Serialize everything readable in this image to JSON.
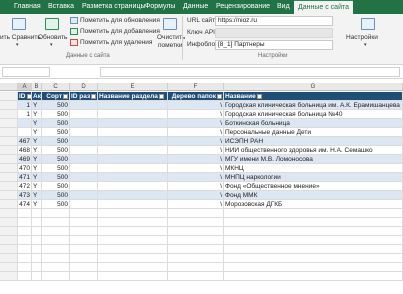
{
  "ribbon_tabs": [
    {
      "label": "Главная",
      "active": false
    },
    {
      "label": "Вставка",
      "active": false
    },
    {
      "label": "Разметка страницы",
      "active": false
    },
    {
      "label": "Формулы",
      "active": false
    },
    {
      "label": "Данные",
      "active": false
    },
    {
      "label": "Рецензирование",
      "active": false
    },
    {
      "label": "Вид",
      "active": false
    },
    {
      "label": "Данные с сайта",
      "active": true
    }
  ],
  "ribbon": {
    "btn_compare": "ить Сравнить",
    "btn_update": "Обновить",
    "mark_update": "Пометить для обновления",
    "mark_add": "Пометить для добавления",
    "mark_delete": "Пометить для удаления",
    "clear_marks_line1": "Очистить",
    "clear_marks_line2": "пометки",
    "group_label": "Данные с сайта",
    "site_url_label": "URL сайта",
    "site_url_value": "https://nioz.ru",
    "api_key_label": "Ключ API",
    "infoblock_label": "Инфоблок",
    "infoblock_value": "[8_1] Партнеры",
    "settings_label": "Настройки",
    "settings_group_label": "Настройки"
  },
  "columns": [
    {
      "letter": "A"
    },
    {
      "letter": "B"
    },
    {
      "letter": "C"
    },
    {
      "letter": "D"
    },
    {
      "letter": "E"
    },
    {
      "letter": "F"
    },
    {
      "letter": "G"
    }
  ],
  "table": {
    "headers": [
      "ID",
      "Акт",
      "Сорт",
      "ID раз",
      "Название раздела",
      "Дерево папок",
      "Название"
    ],
    "rows": [
      {
        "id": "1",
        "active": "Y",
        "sort": "500",
        "tree": "\\",
        "name": "Городская клиническая больница им. А.К. Ерамишанцева"
      },
      {
        "id": "1",
        "active": "Y",
        "sort": "500",
        "tree": "\\",
        "name": "Городская клиническая больница №40"
      },
      {
        "id": "",
        "active": "Y",
        "sort": "500",
        "tree": "\\",
        "name": "Боткинская больница"
      },
      {
        "id": "",
        "active": "Y",
        "sort": "500",
        "tree": "\\",
        "name": "Персональные данные Дети"
      },
      {
        "id": "467",
        "active": "Y",
        "sort": "500",
        "tree": "\\",
        "name": "ИСЭПН РАН"
      },
      {
        "id": "468",
        "active": "Y",
        "sort": "500",
        "tree": "\\",
        "name": "НИИ общественного здоровья им. Н.А. Семашко"
      },
      {
        "id": "469",
        "active": "Y",
        "sort": "500",
        "tree": "\\",
        "name": "МГУ имени М.В. Ломоносова"
      },
      {
        "id": "470",
        "active": "Y",
        "sort": "500",
        "tree": "\\",
        "name": "МКНЦ"
      },
      {
        "id": "471",
        "active": "Y",
        "sort": "500",
        "tree": "\\",
        "name": "МНПЦ наркологии"
      },
      {
        "id": "472",
        "active": "Y",
        "sort": "500",
        "tree": "\\",
        "name": "Фонд «Общественное мнение»"
      },
      {
        "id": "473",
        "active": "Y",
        "sort": "500",
        "tree": "\\",
        "name": "Фонд ММК"
      },
      {
        "id": "474",
        "active": "Y",
        "sort": "500",
        "tree": "\\",
        "name": "Морозовская ДГКБ"
      }
    ]
  },
  "colors": {
    "ribbon_green": "#217346",
    "header_fill": "#1f4e79",
    "band_fill": "#dde7f3"
  }
}
